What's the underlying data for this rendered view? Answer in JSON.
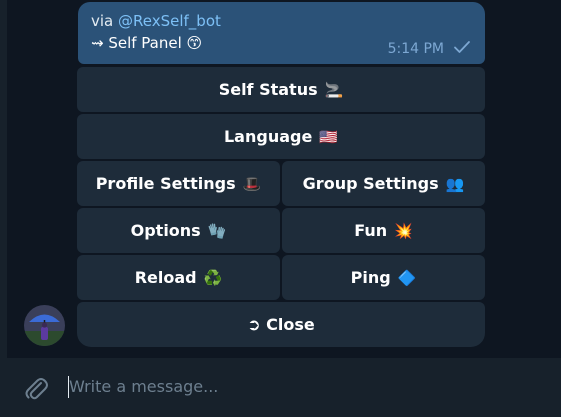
{
  "message": {
    "via_prefix": "via ",
    "via_bot": "@RexSelf_bot",
    "text": "⇝ Self Panel 😙",
    "time": "5:14 PM"
  },
  "keyboard": {
    "rows": [
      [
        {
          "label": "Self Status",
          "emoji": "🚬"
        }
      ],
      [
        {
          "label": "Language",
          "emoji": "🇺🇸"
        }
      ],
      [
        {
          "label": "Profile Settings",
          "emoji": "🎩"
        },
        {
          "label": "Group Settings",
          "emoji": "👥"
        }
      ],
      [
        {
          "label": "Options",
          "emoji": "🧤"
        },
        {
          "label": "Fun",
          "emoji": "💥"
        }
      ],
      [
        {
          "label": "Reload",
          "emoji": "♻️"
        },
        {
          "label": "Ping",
          "emoji": "🔷"
        }
      ],
      [
        {
          "label": "➲ Close",
          "emoji": ""
        }
      ]
    ]
  },
  "composer": {
    "placeholder": "Write a message..."
  },
  "icons": {
    "attach": "paperclip-icon",
    "read_status": "check-icon"
  },
  "colors": {
    "chat_bg": "#0e1621",
    "bubble_bg": "#2b5278",
    "button_bg": "#1e2c3a",
    "composer_bg": "#17212b",
    "link": "#7dc0f6"
  }
}
